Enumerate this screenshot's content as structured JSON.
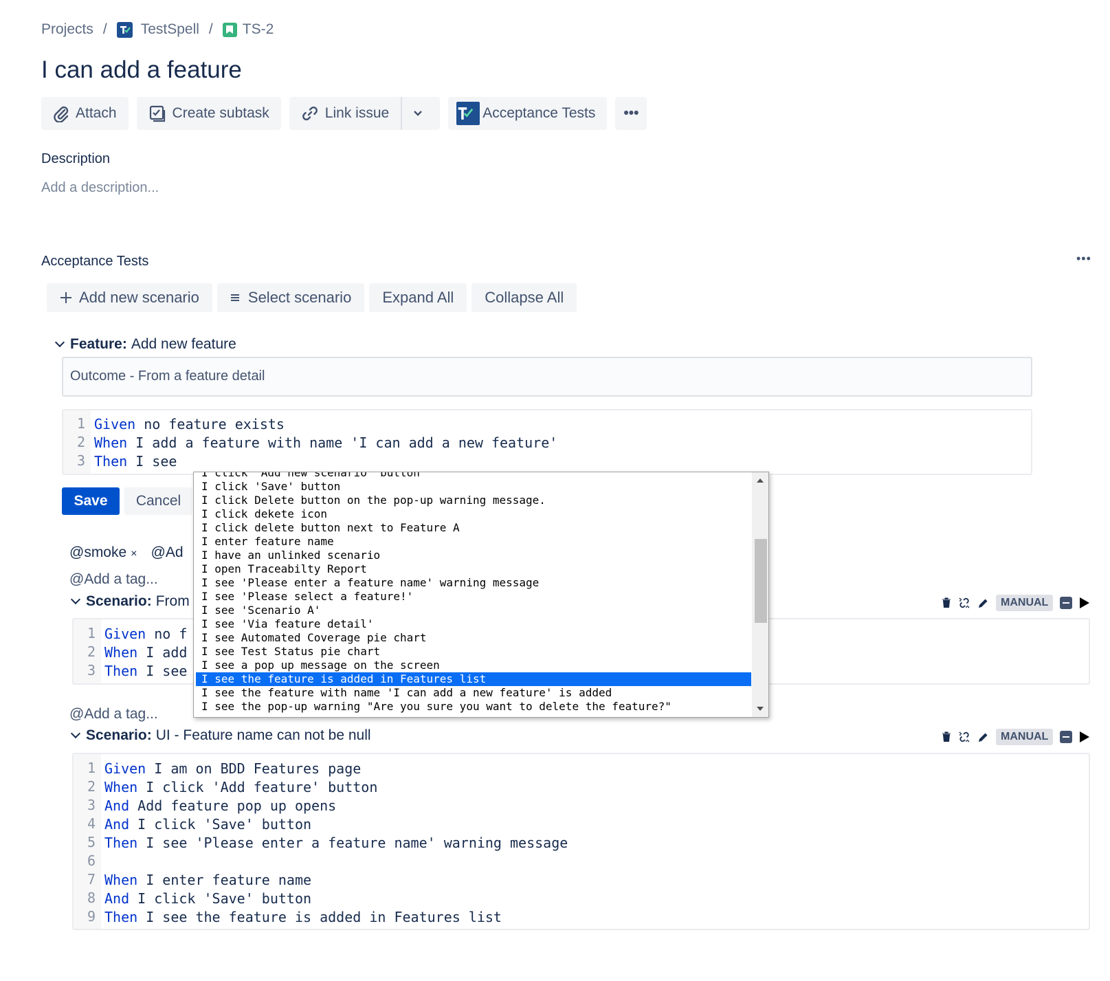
{
  "breadcrumb": {
    "projects": "Projects",
    "project": "TestSpell",
    "issue": "TS-2",
    "separator": "/"
  },
  "title": "I can add a feature",
  "toolbar": {
    "attach": "Attach",
    "create_subtask": "Create subtask",
    "link_issue": "Link issue",
    "acceptance_tests": "Acceptance Tests",
    "more": "•••"
  },
  "description": {
    "label": "Description",
    "placeholder": "Add a description..."
  },
  "acceptance_tests": {
    "label": "Acceptance Tests",
    "more": "•••",
    "add_new_scenario": "Add new scenario",
    "select_scenario": "Select scenario",
    "expand_all": "Expand All",
    "collapse_all": "Collapse All"
  },
  "feature": {
    "keyword": "Feature:",
    "name": "Add new feature",
    "outcome": "Outcome - From a feature detail",
    "editor": [
      {
        "n": "1",
        "kw": "Given",
        "text": " no feature exists"
      },
      {
        "n": "2",
        "kw": "When",
        "text": " I add a feature with name 'I can add a new feature'"
      },
      {
        "n": "3",
        "kw": "Then",
        "text": " I see"
      }
    ],
    "save": "Save",
    "cancel": "Cancel"
  },
  "autocomplete": {
    "items": [
      "I click 'Add new scenario' button",
      "I click 'Save' button",
      "I click Delete button on the pop-up warning message.",
      "I click dekete icon",
      "I click delete button next to Feature A",
      "I enter feature name",
      "I have an unlinked scenario",
      "I open Traceabilty Report",
      "I see 'Please enter a feature name' warning message",
      "I see 'Please select a feature!'",
      "I see 'Scenario A'",
      "I see 'Via feature detail'",
      "I see Automated Coverage pie chart",
      "I see Test Status pie chart",
      "I see a pop up message on the screen",
      "I see the feature is added in Features list",
      "I see the feature with name 'I can add a new feature' is added",
      "I see the pop-up warning \"Are you sure you want to delete the feature?\""
    ],
    "selected_index": 15
  },
  "tags": {
    "tag1": "@smoke",
    "tag2": "@Ad",
    "remove": "×",
    "add_tag": "@Add a tag..."
  },
  "scenario1": {
    "keyword": "Scenario:",
    "name": "From",
    "badge": "MANUAL",
    "add_tag": "@Add a tag...",
    "editor": [
      {
        "n": "1",
        "kw": "Given",
        "text": " no f"
      },
      {
        "n": "2",
        "kw": "When",
        "text": " I add"
      },
      {
        "n": "3",
        "kw": "Then",
        "text": " I see"
      }
    ]
  },
  "scenario2": {
    "keyword": "Scenario:",
    "name": "UI - Feature name can not be null",
    "badge": "MANUAL",
    "add_tag": "@Add a tag...",
    "editor": [
      {
        "n": "1",
        "kw": "Given",
        "text": " I am on BDD Features page"
      },
      {
        "n": "2",
        "kw": "When",
        "text": " I click 'Add feature' button"
      },
      {
        "n": "3",
        "kw": "And",
        "text": " Add feature pop up opens"
      },
      {
        "n": "4",
        "kw": "And",
        "text": " I click 'Save' button"
      },
      {
        "n": "5",
        "kw": "Then",
        "text": " I see 'Please enter a feature name' warning message"
      },
      {
        "n": "6",
        "kw": "",
        "text": ""
      },
      {
        "n": "7",
        "kw": "When",
        "text": " I enter feature name"
      },
      {
        "n": "8",
        "kw": "And",
        "text": " I click 'Save' button"
      },
      {
        "n": "9",
        "kw": "Then",
        "text": " I see the feature is added in Features list"
      }
    ]
  },
  "colors": {
    "primary": "#0052cc",
    "keyword": "#0033cc",
    "selection": "#0a6ef5",
    "button_bg": "#f4f5f7"
  }
}
